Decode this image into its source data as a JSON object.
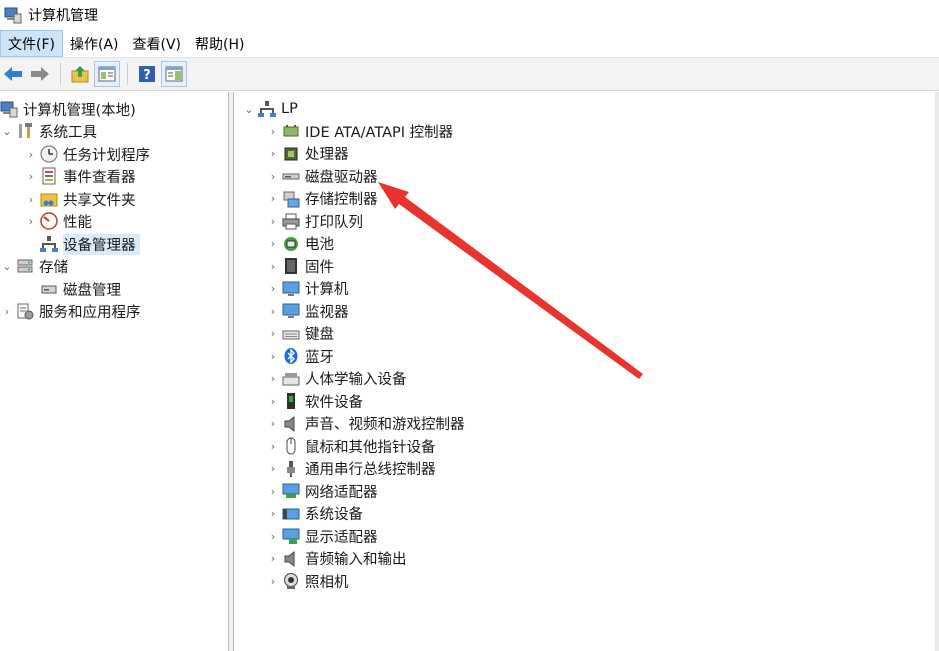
{
  "window": {
    "title": "计算机管理"
  },
  "menu": [
    "文件(F)",
    "操作(A)",
    "查看(V)",
    "帮助(H)"
  ],
  "left_tree": {
    "root": "计算机管理(本地)",
    "system_tools": "系统工具",
    "task_scheduler": "任务计划程序",
    "event_viewer": "事件查看器",
    "shared_folders": "共享文件夹",
    "performance": "性能",
    "device_manager": "设备管理器",
    "storage": "存储",
    "disk_management": "磁盘管理",
    "services_apps": "服务和应用程序"
  },
  "device_tree": {
    "root": "LP",
    "categories": [
      "IDE ATA/ATAPI 控制器",
      "处理器",
      "磁盘驱动器",
      "存储控制器",
      "打印队列",
      "电池",
      "固件",
      "计算机",
      "监视器",
      "键盘",
      "蓝牙",
      "人体学输入设备",
      "软件设备",
      "声音、视频和游戏控制器",
      "鼠标和其他指针设备",
      "通用串行总线控制器",
      "网络适配器",
      "系统设备",
      "显示适配器",
      "音频输入和输出",
      "照相机"
    ]
  },
  "colors": {
    "annotation_arrow": "#e8342c",
    "selection": "#d9ebf9"
  }
}
